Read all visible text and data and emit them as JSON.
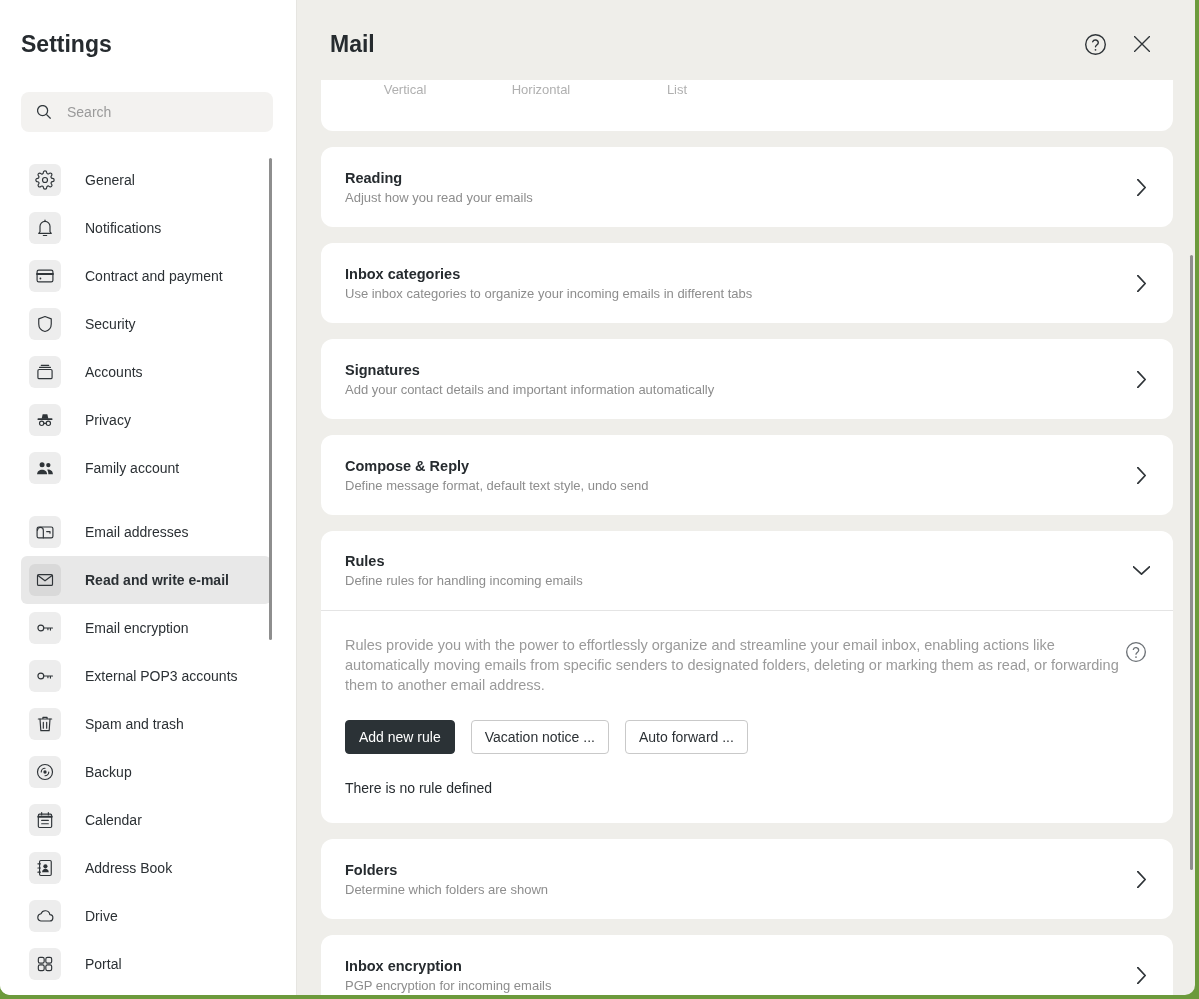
{
  "sidebar": {
    "title": "Settings",
    "search": {
      "placeholder": "Search"
    },
    "groups": [
      {
        "items": [
          {
            "label": "General",
            "selected": false
          },
          {
            "label": "Notifications",
            "selected": false
          },
          {
            "label": "Contract and payment",
            "selected": false
          },
          {
            "label": "Security",
            "selected": false
          },
          {
            "label": "Accounts",
            "selected": false
          },
          {
            "label": "Privacy",
            "selected": false
          },
          {
            "label": "Family account",
            "selected": false
          }
        ]
      },
      {
        "items": [
          {
            "label": "Email addresses",
            "selected": false
          },
          {
            "label": "Read and write e-mail",
            "selected": true
          },
          {
            "label": "Email encryption",
            "selected": false
          },
          {
            "label": "External POP3 accounts",
            "selected": false
          },
          {
            "label": "Spam and trash",
            "selected": false
          },
          {
            "label": "Backup",
            "selected": false
          },
          {
            "label": "Calendar",
            "selected": false
          },
          {
            "label": "Address Book",
            "selected": false
          },
          {
            "label": "Drive",
            "selected": false
          },
          {
            "label": "Portal",
            "selected": false
          }
        ]
      }
    ]
  },
  "main": {
    "title": "Mail",
    "partial_card": {
      "options": [
        "Vertical",
        "Horizontal",
        "List"
      ]
    },
    "sections": [
      {
        "title": "Reading",
        "description": "Adjust how you read your emails",
        "expanded": false
      },
      {
        "title": "Inbox categories",
        "description": "Use inbox categories to organize your incoming emails in different tabs",
        "expanded": false
      },
      {
        "title": "Signatures",
        "description": "Add your contact details and important information automatically",
        "expanded": false
      },
      {
        "title": "Compose & Reply",
        "description": "Define message format, default text style, undo send",
        "expanded": false
      },
      {
        "title": "Rules",
        "description": "Define rules for handling incoming emails",
        "expanded": true,
        "body": {
          "text": "Rules provide you with the power to effortlessly organize and streamline your email inbox, enabling actions like automatically moving emails from specific senders to designated folders, deleting or marking them as read, or forwarding them to another email address.",
          "buttons": [
            {
              "label": "Add new rule",
              "kind": "primary"
            },
            {
              "label": "Vacation notice ...",
              "kind": "secondary"
            },
            {
              "label": "Auto forward ...",
              "kind": "secondary"
            }
          ],
          "empty_message": "There is no rule defined"
        }
      },
      {
        "title": "Folders",
        "description": "Determine which folders are shown",
        "expanded": false
      },
      {
        "title": "Inbox encryption",
        "description": "PGP encryption for incoming emails",
        "expanded": false
      }
    ]
  }
}
